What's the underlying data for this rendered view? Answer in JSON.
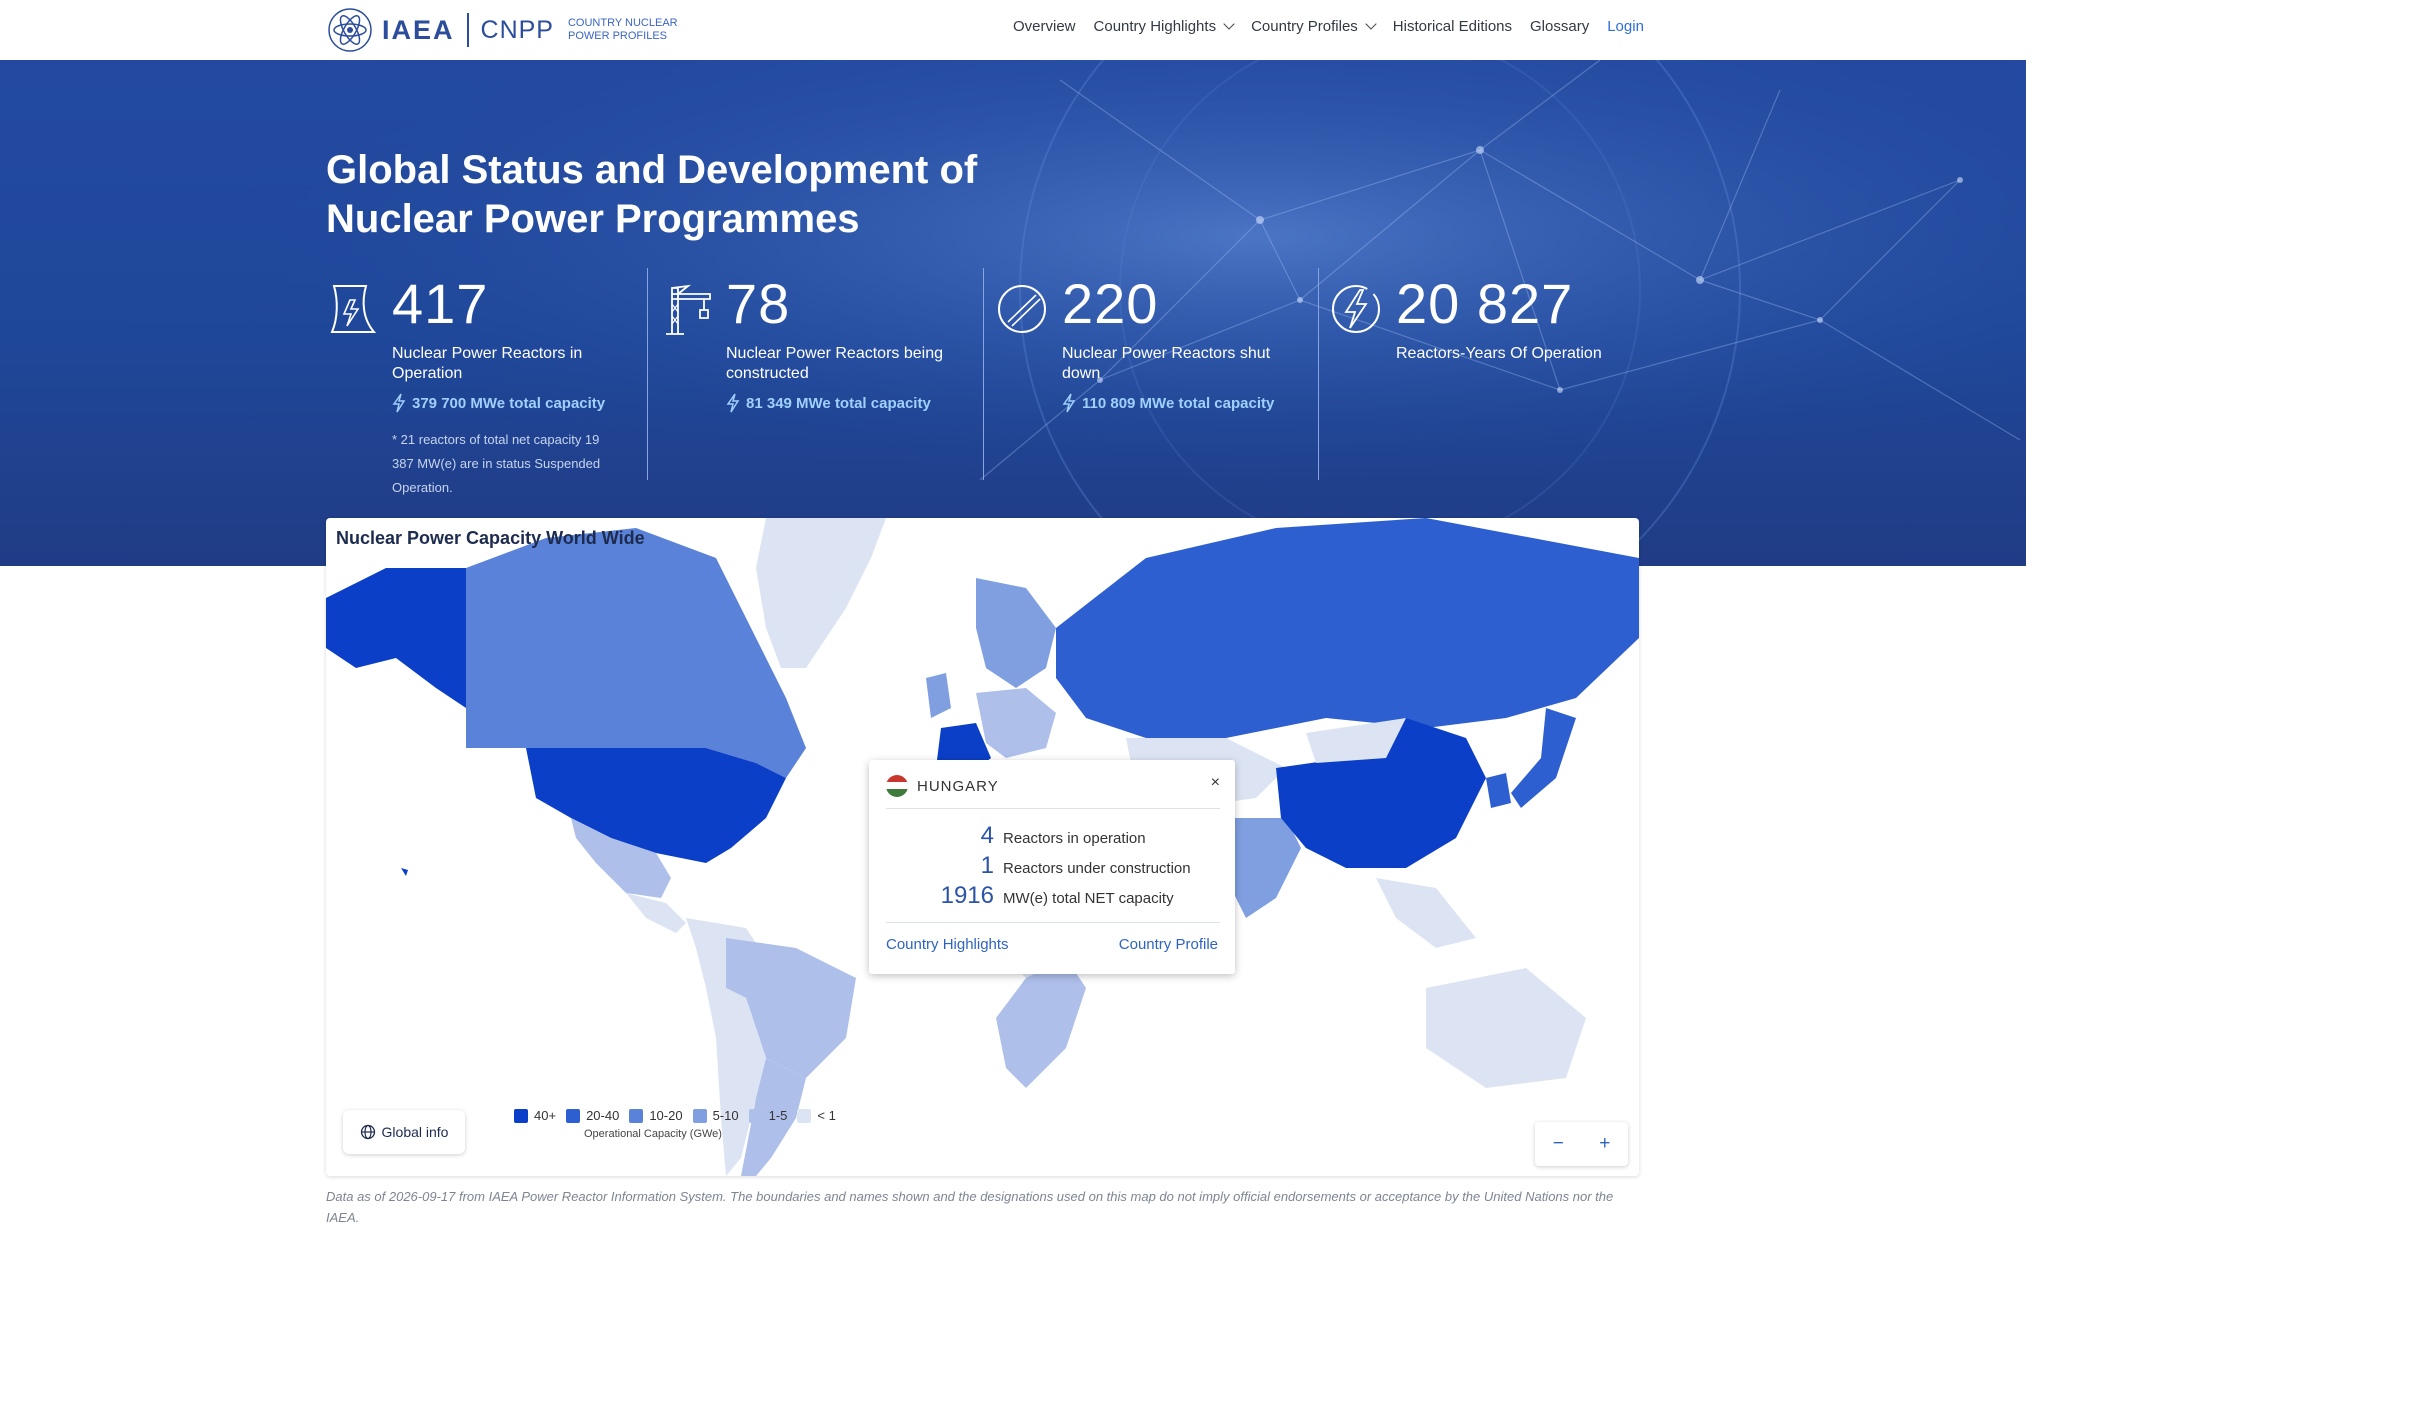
{
  "header": {
    "logo_iaea": "IAEA",
    "logo_cnpp": "CNPP",
    "logo_subtitle": "COUNTRY NUCLEAR POWER PROFILES",
    "nav": {
      "overview": "Overview",
      "country_highlights": "Country Highlights",
      "country_profiles": "Country Profiles",
      "historical_editions": "Historical Editions",
      "glossary": "Glossary",
      "login": "Login"
    }
  },
  "hero": {
    "title": "Global Status and Development of Nuclear Power Programmes",
    "stats": [
      {
        "icon": "cooling-tower-icon",
        "value": "417",
        "label": "Nuclear Power Reactors in Operation",
        "capacity": "379 700 MWe total capacity",
        "note": "* 21 reactors of total net capacity 19 387 MW(e) are in status Suspended Operation."
      },
      {
        "icon": "crane-icon",
        "value": "78",
        "label": "Nuclear Power Reactors being constructed",
        "capacity": "81 349 MWe total capacity"
      },
      {
        "icon": "shutdown-icon",
        "value": "220",
        "label": "Nuclear Power Reactors shut down",
        "capacity": "110 809 MWe total capacity"
      },
      {
        "icon": "lightning-circle-icon",
        "value": "20 827",
        "label": "Reactors-Years Of Operation"
      }
    ]
  },
  "map": {
    "title": "Nuclear Power Capacity World Wide",
    "colors": {
      "c40": "#0b3fc8",
      "c20": "#2d5fd0",
      "c10": "#5a82d8",
      "c5": "#7f9fe0",
      "c1": "#aebfea",
      "c0": "#dce4f4"
    },
    "popup": {
      "country": "HUNGARY",
      "rows": [
        {
          "value": "4",
          "text": "Reactors in operation"
        },
        {
          "value": "1",
          "text": "Reactors under construction"
        },
        {
          "value": "1916",
          "text": "MW(e) total NET capacity"
        }
      ],
      "link_highlights": "Country Highlights",
      "link_profile": "Country Profile",
      "close": "×"
    },
    "global_info": "Global info",
    "legend": {
      "items": [
        {
          "label": "40+",
          "color": "#0b3fc8"
        },
        {
          "label": "20-40",
          "color": "#2d5fd0"
        },
        {
          "label": "10-20",
          "color": "#5a82d8"
        },
        {
          "label": "5-10",
          "color": "#7f9fe0"
        },
        {
          "label": "1-5",
          "color": "#aebfea"
        },
        {
          "label": "< 1",
          "color": "#dce4f4"
        }
      ],
      "caption": "Operational Capacity (GWe)"
    },
    "zoom_out": "−",
    "zoom_in": "+"
  },
  "disclaimer": "Data as of 2026-09-17 from IAEA Power Reactor Information System. The boundaries and names shown and the designations used on this map do not imply official endorsements or acceptance by the United Nations nor the IAEA."
}
